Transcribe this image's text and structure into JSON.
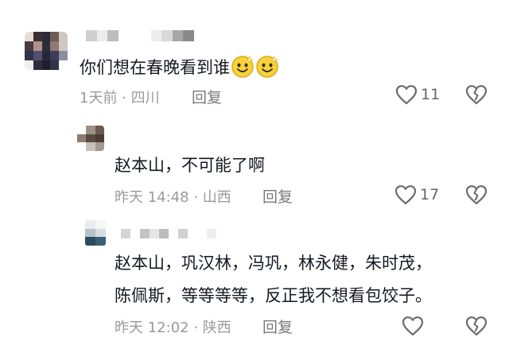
{
  "comments": [
    {
      "text": "你们想在春晚看到谁",
      "emoji": [
        "smiling-emoji",
        "smiling-emoji"
      ],
      "meta": "1天前 · 四川",
      "reply_label": "回复",
      "likes": "11"
    },
    {
      "text": "赵本山，不可能了啊",
      "meta": "昨天 14:48 · 山西",
      "reply_label": "回复",
      "likes": "17"
    },
    {
      "text_line1": "赵本山，巩汉林，冯巩，林永健，朱时茂，",
      "text_line2": "陈佩斯，等等等等，反正我不想看包饺子。",
      "meta": "昨天 12:02 · 陕西",
      "reply_label": "回复"
    }
  ],
  "icons": {
    "like": "heart-outline-icon",
    "dislike": "broken-heart-icon"
  },
  "colors": {
    "text": "#161823",
    "meta": "#9a9a9a",
    "icon": "#6b6b6b"
  }
}
